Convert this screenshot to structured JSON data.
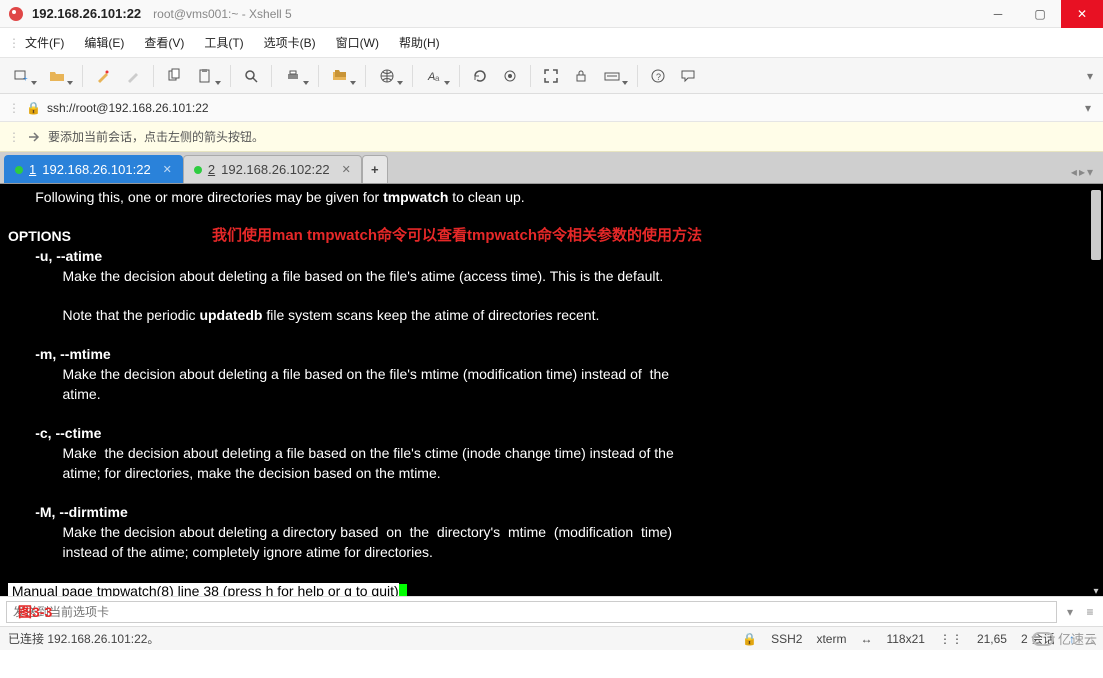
{
  "title": {
    "host": "192.168.26.101:22",
    "sub": "root@vms001:~ - Xshell 5"
  },
  "menu": {
    "file": "文件(F)",
    "edit": "编辑(E)",
    "view": "查看(V)",
    "tools": "工具(T)",
    "tabs": "选项卡(B)",
    "window": "窗口(W)",
    "help": "帮助(H)"
  },
  "address": {
    "url": "ssh://root@192.168.26.101:22"
  },
  "hint": {
    "text": "要添加当前会话，点击左侧的箭头按钮。"
  },
  "tabs": {
    "items": [
      {
        "num": "1",
        "label": "192.168.26.101:22"
      },
      {
        "num": "2",
        "label": "192.168.26.102:22"
      }
    ],
    "add": "+"
  },
  "note": {
    "red": "我们使用man tmpwatch命令可以查看tmpwatch命令相关参数的使用方法"
  },
  "term": {
    "l1a": "       Following this, one or more directories may be given for ",
    "l1b": "tmpwatch",
    "l1c": " to clean up.",
    "opt_hdr": "OPTIONS",
    "u_flag": "       -u, --atime",
    "u_desc": "              Make the decision about deleting a file based on the file's atime (access time). This is the default.",
    "u_note_a": "              Note that the periodic ",
    "u_note_b": "updatedb",
    "u_note_c": " file system scans keep the atime of directories recent.",
    "m_flag": "       -m, --mtime",
    "m_desc": "              Make the decision about deleting a file based on the file's mtime (modification time) instead of  the\n              atime.",
    "c_flag": "       -c, --ctime",
    "c_desc": "              Make  the decision about deleting a file based on the file's ctime (inode change time) instead of the\n              atime; for directories, make the decision based on the mtime.",
    "M_flag": "       -M, --dirmtime",
    "M_desc": "              Make the decision about deleting a directory based  on  the  directory's  mtime  (modification  time)\n              instead of the atime; completely ignore atime for directories.",
    "manline": " Manual page tmpwatch(8) line 38 (press h for help or q to quit)"
  },
  "inputrow": {
    "placeholder": "发送到当前选项卡",
    "overlay": "图3-3"
  },
  "status": {
    "conn": "已连接 192.168.26.101:22。",
    "proto": "SSH2",
    "term": "xterm",
    "size": "118x21",
    "pos": "21,65",
    "sess": "2 会话",
    "logo": "亿速云"
  }
}
